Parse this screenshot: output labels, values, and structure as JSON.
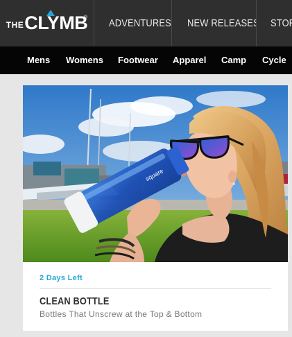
{
  "header": {
    "logo_prefix": "THE",
    "logo_brand": "CLYMB",
    "logo_mark": "®",
    "nav": [
      {
        "label": "ADVENTURES"
      },
      {
        "label": "NEW RELEASES"
      },
      {
        "label": "STORE"
      }
    ]
  },
  "categories": [
    {
      "label": "Mens"
    },
    {
      "label": "Womens"
    },
    {
      "label": "Footwear"
    },
    {
      "label": "Apparel"
    },
    {
      "label": "Camp"
    },
    {
      "label": "Cycle"
    }
  ],
  "product_card": {
    "time_left": "2 Days Left",
    "title": "CLEAN BOTTLE",
    "subtitle": "Bottles That Unscrew at the Top & Bottom",
    "bottle_text": "square"
  },
  "colors": {
    "header_bg": "#2f2f2f",
    "category_bg": "#050505",
    "accent": "#27a9d8",
    "page_bg": "#e6e6e6"
  }
}
